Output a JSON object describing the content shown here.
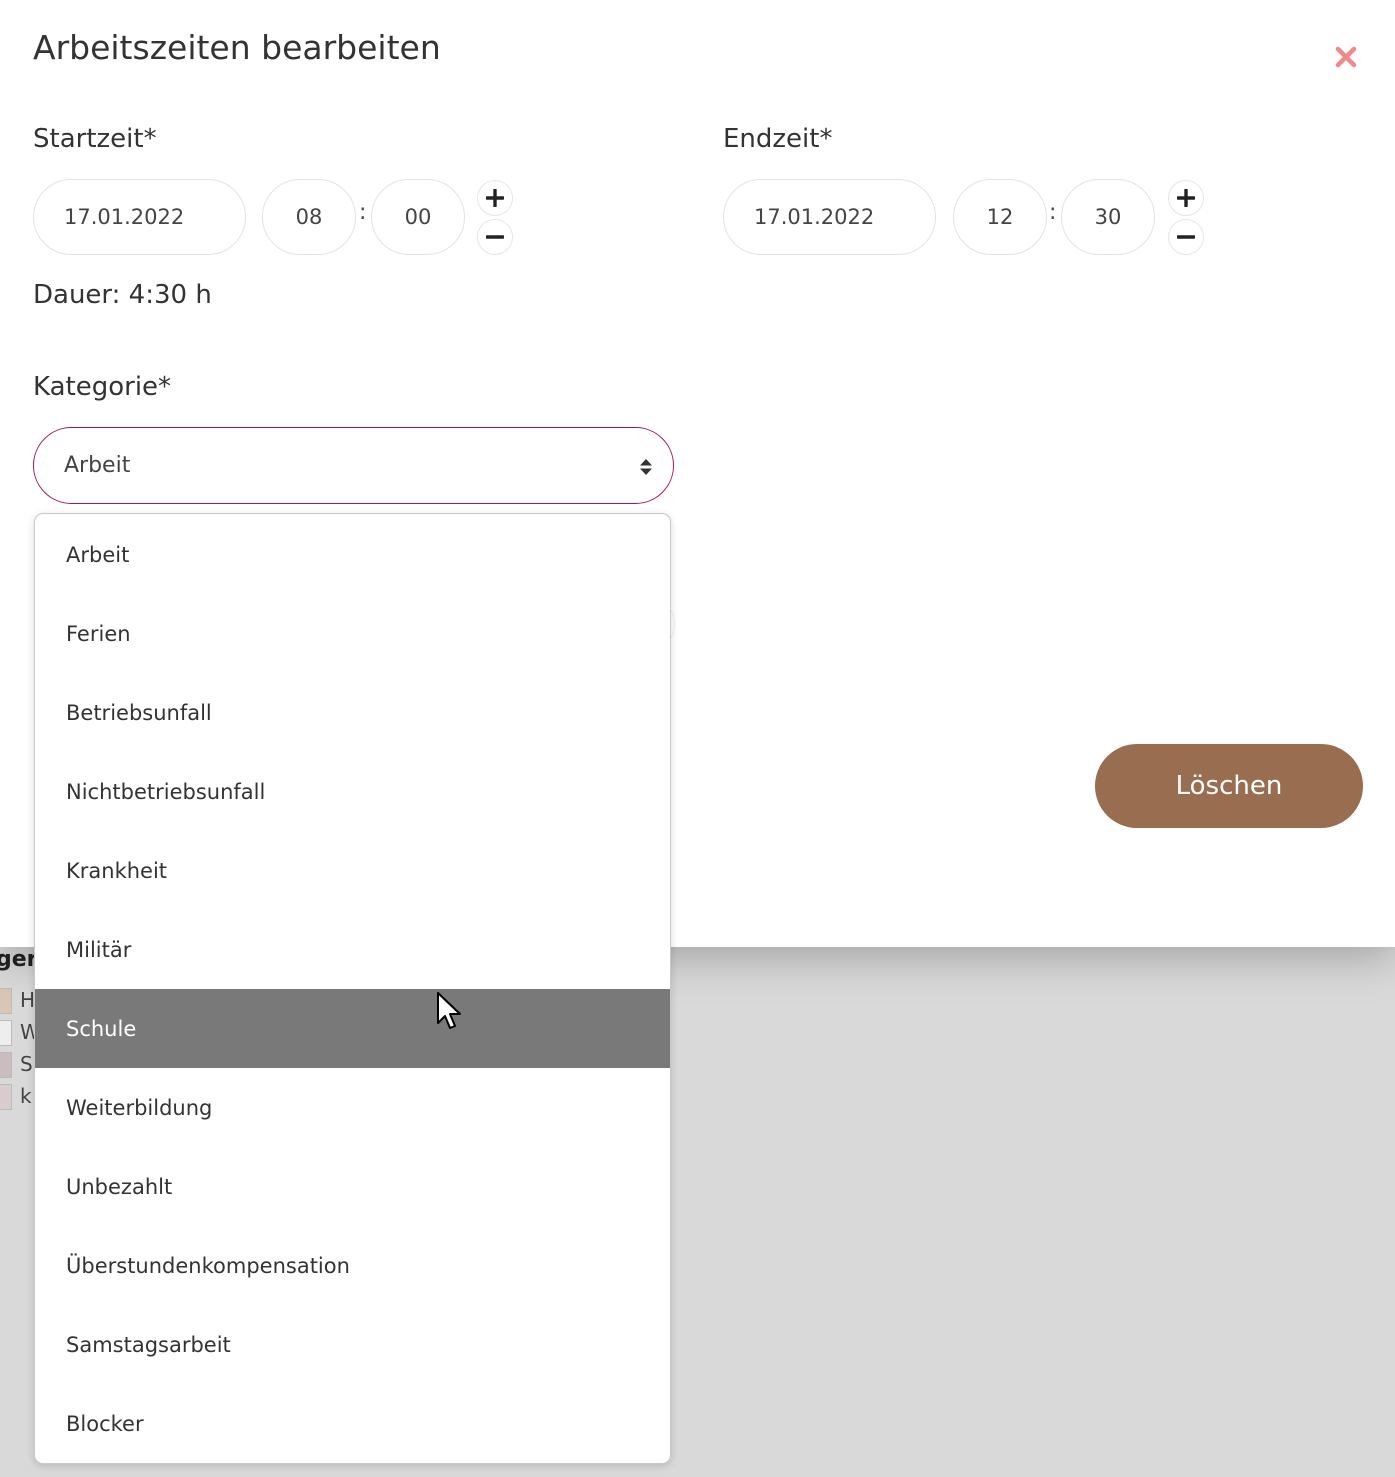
{
  "background": {
    "legend_heading_fragment": "ger",
    "legend_items": [
      {
        "letter": "H",
        "color": "#d9c6b4"
      },
      {
        "letter": "W",
        "color": "#eeeeee"
      },
      {
        "letter": "S",
        "color": "#cbbcbd"
      },
      {
        "letter": "k",
        "color": "#d8cdcd"
      }
    ]
  },
  "modal": {
    "title": "Arbeitszeiten bearbeiten",
    "close_icon": "close-icon",
    "start": {
      "label": "Startzeit*",
      "date": "17.01.2022",
      "hour": "08",
      "minute": "00",
      "separator": ":"
    },
    "end": {
      "label": "Endzeit*",
      "date": "17.01.2022",
      "hour": "12",
      "minute": "30",
      "separator": ":"
    },
    "duration": "Dauer: 4:30 h",
    "category": {
      "label": "Kategorie*",
      "selected": "Arbeit",
      "options": [
        "Arbeit",
        "Ferien",
        "Betriebsunfall",
        "Nichtbetriebsunfall",
        "Krankheit",
        "Militär",
        "Schule",
        "Weiterbildung",
        "Unbezahlt",
        "Überstundenkompensation",
        "Samstagsarbeit",
        "Blocker"
      ],
      "hovered_option": "Schule"
    },
    "delete_label": "Löschen"
  },
  "colors": {
    "accent_border": "#a0195a",
    "delete_button": "#986d50",
    "close_icon": "#f08a8a",
    "hover_option": "#797979"
  }
}
